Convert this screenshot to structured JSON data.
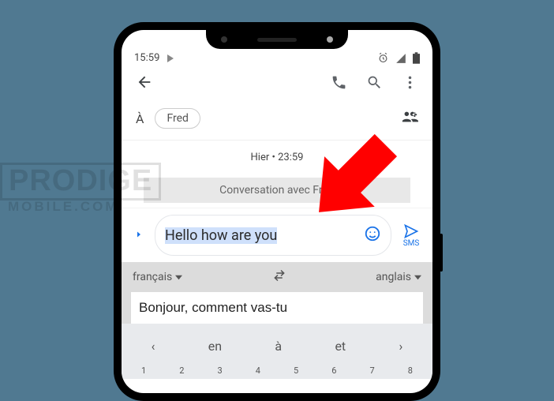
{
  "status": {
    "time": "15:59"
  },
  "recipient": {
    "label": "À",
    "chip": "Fred"
  },
  "chat": {
    "meta_day": "Hier",
    "meta_dot": " • ",
    "meta_time": "23:59",
    "banner": "Conversation avec Fred"
  },
  "composer": {
    "text": "Hello how are you",
    "send_label": "SMS"
  },
  "translate": {
    "source": "français",
    "target": "anglais",
    "input": "Bonjour, comment vas-tu"
  },
  "keyboard": {
    "suggest": [
      "en",
      "à",
      "et"
    ],
    "numrow": [
      "1",
      "2",
      "3",
      "4",
      "5",
      "6",
      "7",
      "8"
    ]
  },
  "watermark": {
    "line1": "PRODIGE",
    "line2": "MOBILE.COM"
  }
}
